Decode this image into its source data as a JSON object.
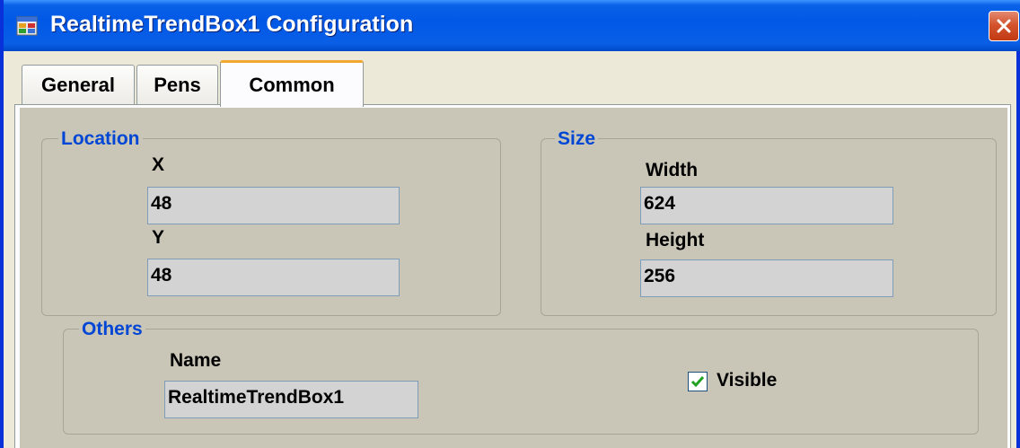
{
  "window": {
    "title": "RealtimeTrendBox1 Configuration",
    "accent_color": "#0058e6",
    "close_button_icon": "close-icon"
  },
  "tabs": [
    {
      "label": "General",
      "active": false
    },
    {
      "label": "Pens",
      "active": false
    },
    {
      "label": "Common",
      "active": true
    }
  ],
  "location": {
    "legend": "Location",
    "x_label": "X",
    "x_value": "48",
    "y_label": "Y",
    "y_value": "48"
  },
  "size": {
    "legend": "Size",
    "width_label": "Width",
    "width_value": "624",
    "height_label": "Height",
    "height_value": "256"
  },
  "others": {
    "legend": "Others",
    "name_label": "Name",
    "name_value": "RealtimeTrendBox1",
    "visible_label": "Visible",
    "visible_checked": true
  }
}
